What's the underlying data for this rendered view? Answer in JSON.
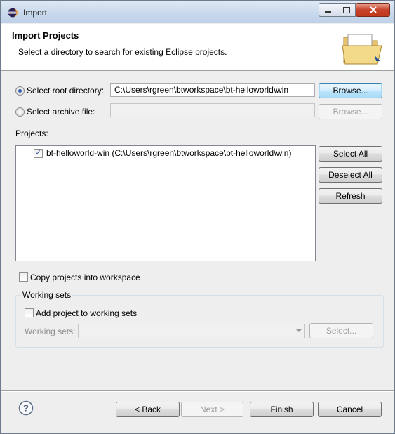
{
  "window": {
    "title": "Import"
  },
  "header": {
    "title": "Import Projects",
    "description": "Select a directory to search for existing Eclipse projects."
  },
  "root_directory": {
    "label": "Select root directory:",
    "value": "C:\\Users\\rgreen\\btworkspace\\bt-helloworld\\win",
    "selected": true,
    "browse_label": "Browse..."
  },
  "archive_file": {
    "label": "Select archive file:",
    "value": "",
    "selected": false,
    "browse_label": "Browse..."
  },
  "projects": {
    "label": "Projects:",
    "items": [
      {
        "label": "bt-helloworld-win (C:\\Users\\rgreen\\btworkspace\\bt-helloworld\\win)",
        "checked": true
      }
    ],
    "select_all_label": "Select All",
    "deselect_all_label": "Deselect All",
    "refresh_label": "Refresh"
  },
  "copy_projects": {
    "label": "Copy projects into workspace",
    "checked": false
  },
  "working_sets": {
    "group_title": "Working sets",
    "add_label": "Add project to working sets",
    "add_checked": false,
    "field_label": "Working sets:",
    "select_label": "Select..."
  },
  "footer": {
    "back_label": "< Back",
    "next_label": "Next >",
    "finish_label": "Finish",
    "cancel_label": "Cancel"
  },
  "icons": {
    "app": "eclipse-icon",
    "header": "folder-import-icon",
    "help": "help-icon"
  },
  "colors": {
    "titlebar": "#c9d9ec",
    "close_button": "#c7432a",
    "focus_button": "#3c7fb1",
    "dialog_background": "#eeeeee"
  }
}
